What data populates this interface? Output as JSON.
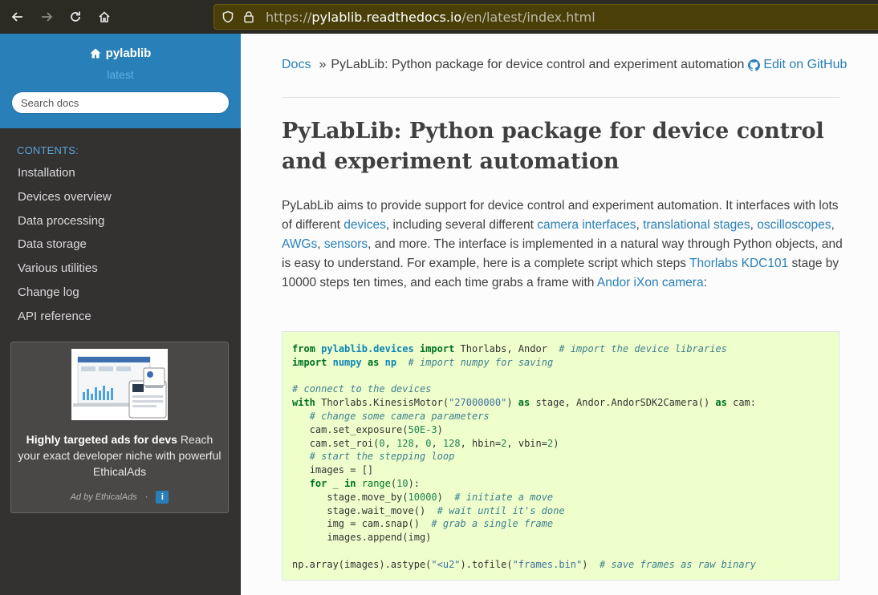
{
  "browser": {
    "url_scheme": "https://",
    "url_host": "pylablib.readthedocs.io",
    "url_path": "/en/latest/index.html"
  },
  "sidebar": {
    "project": "pylablib",
    "version": "latest",
    "search_placeholder": "Search docs",
    "caption": "CONTENTS:",
    "items": [
      "Installation",
      "Devices overview",
      "Data processing",
      "Data storage",
      "Various utilities",
      "Change log",
      "API reference"
    ],
    "ad": {
      "headline": "Highly targeted ads for devs",
      "body": " Reach your exact developer niche with powerful EthicalAds",
      "by": "Ad by EthicalAds",
      "info": "i"
    }
  },
  "breadcrumbs": {
    "docs": "Docs",
    "sep": "»",
    "current": "PyLabLib: Python package for device control and experiment automation",
    "edit": "Edit on GitHub"
  },
  "page": {
    "title": "PyLabLib: Python package for device control and experiment automation",
    "intro": {
      "t1": "PyLabLib aims to provide support for device control and experiment automation. It interfaces with lots of different ",
      "l1": "devices",
      "t2": ", including several different ",
      "l2": "camera interfaces",
      "t3": ", ",
      "l3": "translational stages",
      "t4": ", ",
      "l4": "oscilloscopes",
      "t5": ", ",
      "l5": "AWGs",
      "t6": ", ",
      "l6": "sensors",
      "t7": ", and more. The interface is implemented in a natural way through Python objects, and is easy to understand. For example, here is a complete script which steps ",
      "l7": "Thorlabs KDC101",
      "t8": " stage by 10000 steps ten times, and each time grabs a frame with ",
      "l8": "Andor iXon camera",
      "t9": ":"
    }
  },
  "code": {
    "l1": {
      "kw1": "from",
      "mod": "pylablib.devices",
      "kw2": "import",
      "rest": " Thorlabs, Andor  ",
      "cmt": "# import the device libraries"
    },
    "l2": {
      "kw1": "import",
      "mod": "numpy",
      "kw2": "as",
      "alias": "np",
      "cmt": "# import numpy for saving"
    },
    "l4": {
      "cmt": "# connect to the devices"
    },
    "l5": {
      "kw1": "with",
      "t1": " Thorlabs.KinesisMotor(",
      "str": "\"27000000\"",
      "t2": ") ",
      "kw2": "as",
      "t3": " stage, Andor.AndorSDK2Camera() ",
      "kw3": "as",
      "t4": " cam:"
    },
    "l6": {
      "cmt": "# change some camera parameters"
    },
    "l7": {
      "t1": "cam.set_exposure(",
      "num": "50E-3",
      "t2": ")"
    },
    "l8": {
      "t1": "cam.set_roi(",
      "n1": "0",
      "t2": ", ",
      "n2": "128",
      "t3": ", ",
      "n3": "0",
      "t4": ", ",
      "n4": "128",
      "t5": ", hbin=",
      "n5": "2",
      "t6": ", vbin=",
      "n6": "2",
      "t7": ")"
    },
    "l9": {
      "cmt": "# start the stepping loop"
    },
    "l10": {
      "t1": "images = []"
    },
    "l11": {
      "kw1": "for",
      "t1": " _ ",
      "kw2": "in",
      "t2": " ",
      "bi": "range",
      "t3": "(",
      "num": "10",
      "t4": "):"
    },
    "l12": {
      "t1": "stage.move_by(",
      "num": "10000",
      "t2": ")  ",
      "cmt": "# initiate a move"
    },
    "l13": {
      "t1": "stage.wait_move()  ",
      "cmt": "# wait until it's done"
    },
    "l14": {
      "t1": "img = cam.snap()  ",
      "cmt": "# grab a single frame"
    },
    "l15": {
      "t1": "images.append(img)"
    },
    "l17": {
      "t1": "np.array(images).astype(",
      "s1": "\"<u2\"",
      "t2": ").tofile(",
      "s2": "\"frames.bin\"",
      "t3": ")  ",
      "cmt": "# save frames as raw binary"
    }
  }
}
